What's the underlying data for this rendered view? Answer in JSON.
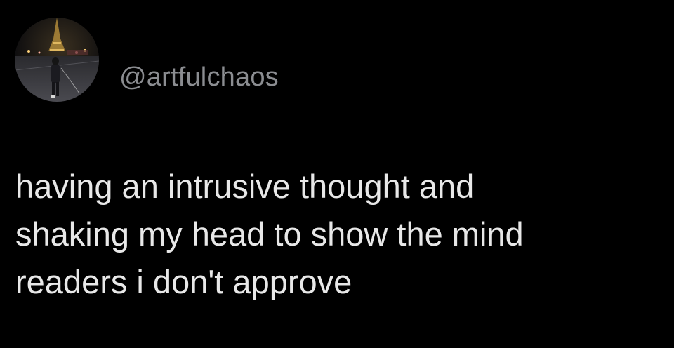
{
  "profile": {
    "avatar_icon": "profile-photo-eiffel-tower-night",
    "handle": "@artfulchaos"
  },
  "tweet": {
    "lines": [
      "having an intrusive thought and",
      "shaking my head to show the mind",
      "readers i don't approve"
    ]
  },
  "colors": {
    "background": "#000000",
    "handle": "#8b8d91",
    "text": "#e8e8e8"
  }
}
